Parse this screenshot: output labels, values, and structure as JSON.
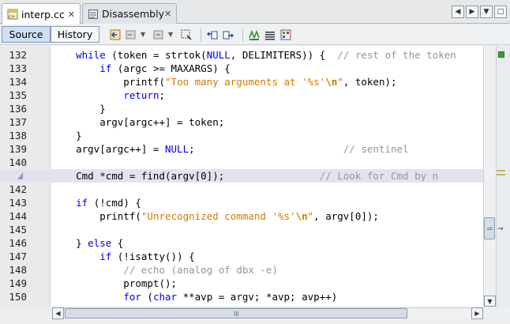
{
  "tabs": [
    {
      "label": "interp.cc",
      "active": true,
      "icon": "cpp-file-icon"
    },
    {
      "label": "Disassembly",
      "active": false,
      "icon": "disassembly-icon"
    }
  ],
  "tab_close_glyph": "✕",
  "toolbar": {
    "source_label": "Source",
    "history_label": "History"
  },
  "editor": {
    "lines": [
      {
        "num": "132",
        "segments": [
          [
            "p",
            "    "
          ],
          [
            "kw",
            "while"
          ],
          [
            "p",
            " (token = strtok("
          ],
          [
            "nl",
            "NULL"
          ],
          [
            "p",
            ", DELIMITERS)) {  "
          ],
          [
            "cm",
            "// rest of the token"
          ]
        ]
      },
      {
        "num": "133",
        "segments": [
          [
            "p",
            "        "
          ],
          [
            "kw",
            "if"
          ],
          [
            "p",
            " (argc >= MAXARGS) {"
          ]
        ]
      },
      {
        "num": "134",
        "segments": [
          [
            "p",
            "            printf("
          ],
          [
            "str",
            "\"Too many arguments at '%s'"
          ],
          [
            "esc",
            "\\n"
          ],
          [
            "str",
            "\""
          ],
          [
            "p",
            ", token);"
          ]
        ]
      },
      {
        "num": "135",
        "segments": [
          [
            "p",
            "            "
          ],
          [
            "kw",
            "return"
          ],
          [
            "p",
            ";"
          ]
        ]
      },
      {
        "num": "136",
        "segments": [
          [
            "p",
            "        }"
          ]
        ]
      },
      {
        "num": "137",
        "segments": [
          [
            "p",
            "        argv[argc++] = token;"
          ]
        ]
      },
      {
        "num": "138",
        "segments": [
          [
            "p",
            "    }"
          ]
        ]
      },
      {
        "num": "139",
        "segments": [
          [
            "p",
            "    argv[argc++] = "
          ],
          [
            "nl",
            "NULL"
          ],
          [
            "p",
            ";                         "
          ],
          [
            "cm",
            "// sentinel"
          ]
        ]
      },
      {
        "num": "140",
        "segments": []
      },
      {
        "num": "",
        "marker": true,
        "highlight": true,
        "segments": [
          [
            "p",
            "    Cmd *cmd = find(argv[0]);                "
          ],
          [
            "cm",
            "// Look for Cmd by n"
          ]
        ]
      },
      {
        "num": "142",
        "segments": []
      },
      {
        "num": "143",
        "segments": [
          [
            "p",
            "    "
          ],
          [
            "kw",
            "if"
          ],
          [
            "p",
            " (!cmd) {"
          ]
        ]
      },
      {
        "num": "144",
        "segments": [
          [
            "p",
            "        printf("
          ],
          [
            "str",
            "\"Unrecognized command '%s'"
          ],
          [
            "esc",
            "\\n"
          ],
          [
            "str",
            "\""
          ],
          [
            "p",
            ", argv[0]);"
          ]
        ]
      },
      {
        "num": "145",
        "segments": []
      },
      {
        "num": "146",
        "segments": [
          [
            "p",
            "    } "
          ],
          [
            "kw",
            "else"
          ],
          [
            "p",
            " {"
          ]
        ]
      },
      {
        "num": "147",
        "segments": [
          [
            "p",
            "        "
          ],
          [
            "kw",
            "if"
          ],
          [
            "p",
            " (!isatty()) {"
          ]
        ]
      },
      {
        "num": "148",
        "segments": [
          [
            "p",
            "            "
          ],
          [
            "cm",
            "// echo (analog of dbx -e)"
          ]
        ]
      },
      {
        "num": "149",
        "segments": [
          [
            "p",
            "            prompt();"
          ]
        ]
      },
      {
        "num": "150",
        "segments": [
          [
            "p",
            "            "
          ],
          [
            "kw",
            "for"
          ],
          [
            "p",
            " ("
          ],
          [
            "kw",
            "char"
          ],
          [
            "p",
            " **avp = argv; *avp; avp++)"
          ]
        ]
      }
    ]
  },
  "colors": {
    "keyword": "#0000e6",
    "string": "#ce7b00",
    "comment": "#969696",
    "current_line": "#e7e1ef",
    "source_button_bg": "#cde0f2"
  }
}
